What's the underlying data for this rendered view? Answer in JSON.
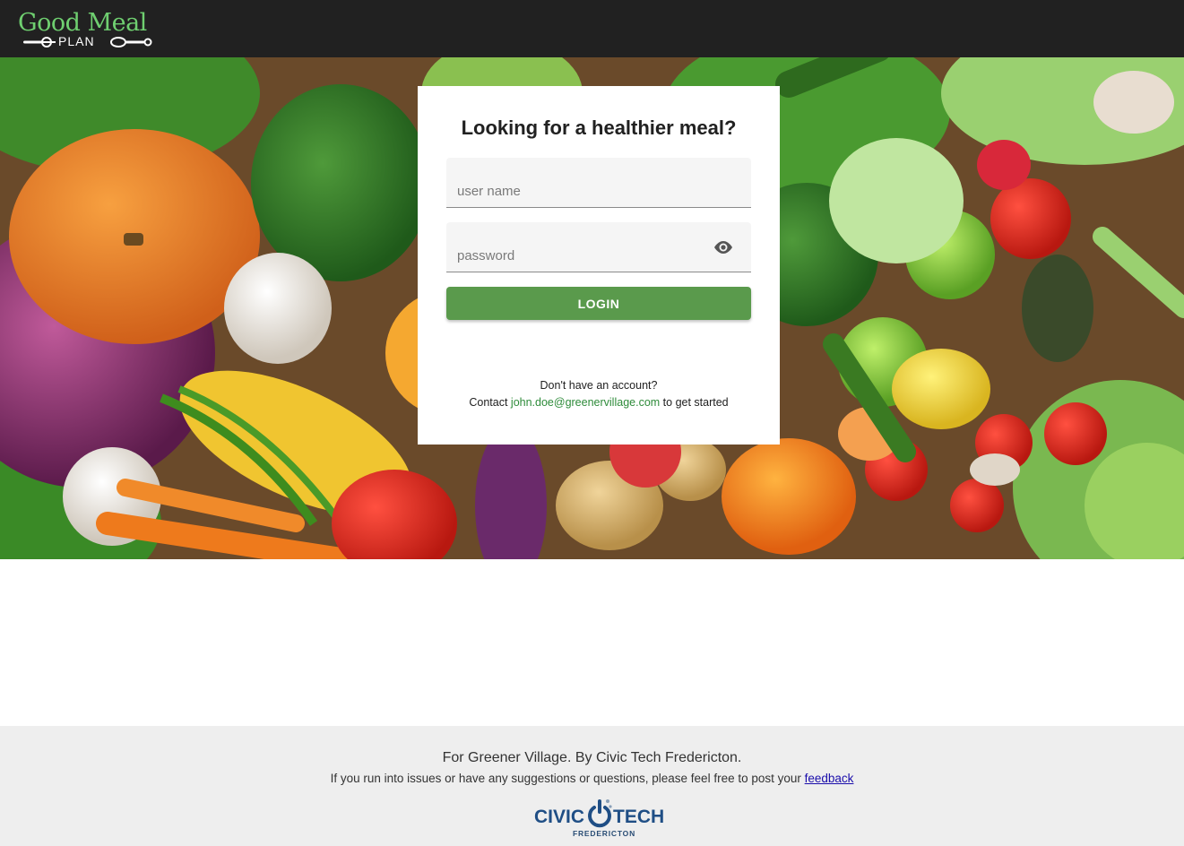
{
  "header": {
    "logo_title": "Good Meal",
    "logo_subtitle": "PLAN"
  },
  "login": {
    "heading": "Looking for a healthier meal?",
    "username_placeholder": "user name",
    "password_placeholder": "password",
    "login_label": "LOGIN",
    "no_account_text": "Don't have an account?",
    "contact_prefix": "Contact",
    "contact_email": "john.doe@greenervillage.com",
    "contact_suffix": "to get started"
  },
  "footer": {
    "title": "For Greener Village. By Civic Tech Fredericton.",
    "note_prefix": "If you run into issues or have any suggestions or questions, please feel free to post your",
    "feedback_label": "feedback",
    "civic_word_left": "CIVIC",
    "civic_word_right": "TECH",
    "civic_sub": "FREDERICTON"
  },
  "colors": {
    "accent_green": "#5a9a4c",
    "logo_green": "#6fcf70",
    "link_green": "#2e8b3a",
    "header_bg": "#212121",
    "footer_bg": "#eeeeee",
    "civic_blue": "#1f4e85"
  },
  "icons": {
    "password_toggle": "eye-icon",
    "logo_cutlery": "fork-knife-icon"
  }
}
